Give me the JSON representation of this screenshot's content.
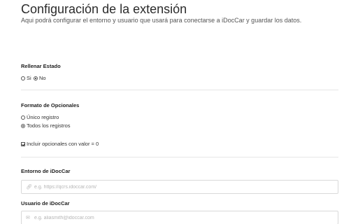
{
  "header": {
    "title": "Configuración de la extensión",
    "subtitle": "Aqui podrá configurar el entorno y usuario que usará para conectarse a iDocCar y guardar los datos."
  },
  "rellenar": {
    "label": "Rellenar Estado",
    "options": [
      "Si",
      "No"
    ],
    "selected": "No"
  },
  "formato": {
    "label": "Formato de Opcionales",
    "options": [
      "Único registro",
      "Todos los registros"
    ],
    "selected": "Todos los registros",
    "checkbox_label": "Incluir opcionales con valor = 0",
    "checkbox_checked": true
  },
  "entorno": {
    "label": "Entorno de iDocCar",
    "placeholder": "e.g. https://qcrs.idoccar.com/",
    "value": "",
    "icon": "link-icon"
  },
  "usuario": {
    "label": "Usuario de iDocCar",
    "placeholder": "e.g. aliasmith@idoccar.com",
    "value": "",
    "icon": "envelope-icon"
  }
}
